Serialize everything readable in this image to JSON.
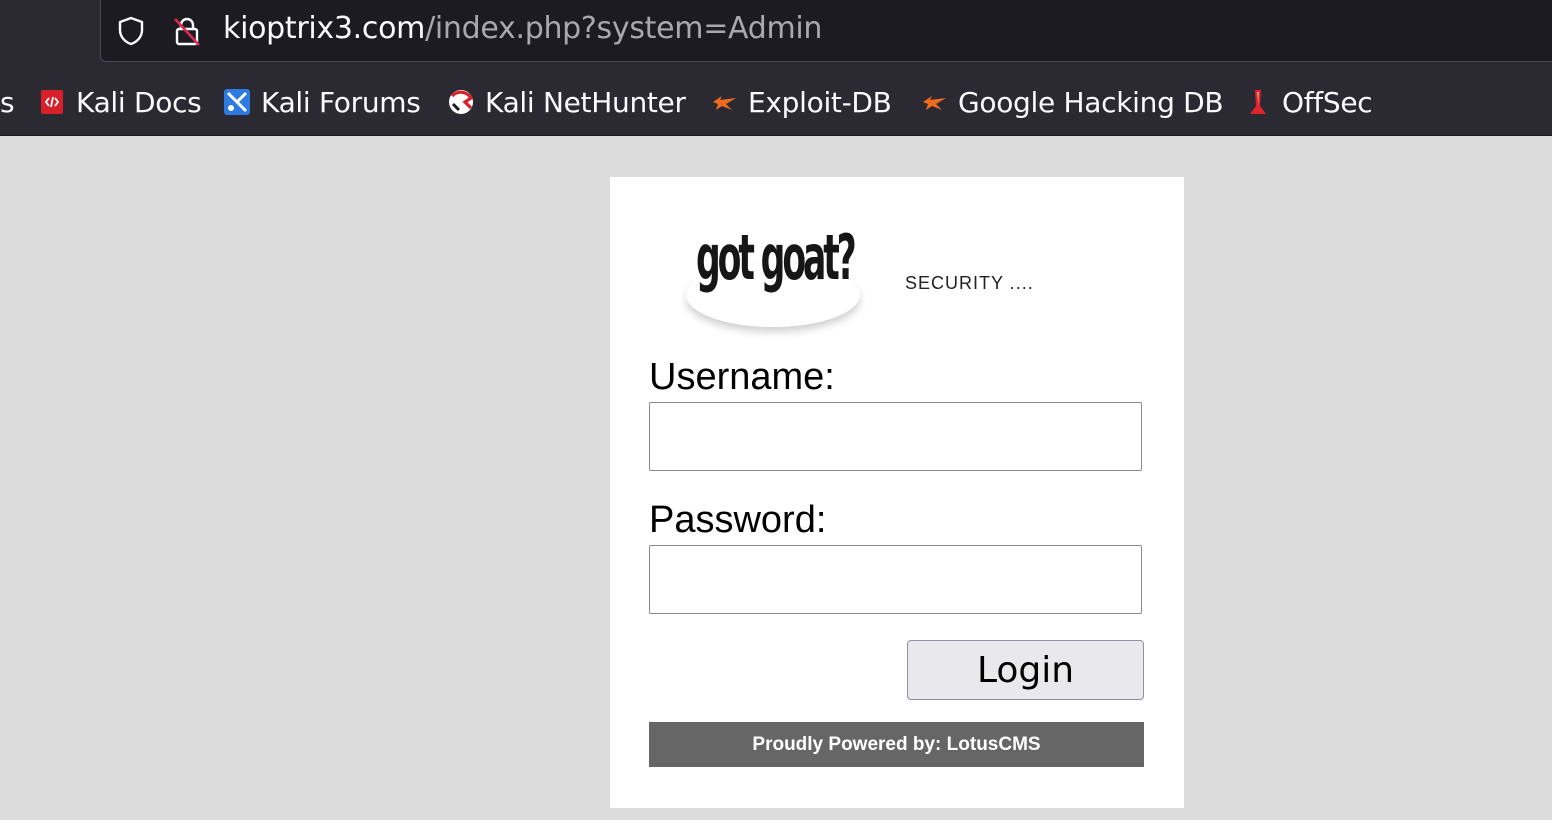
{
  "browser": {
    "url_host": "kioptrix3.com",
    "url_path": "/index.php?system=Admin",
    "bookmarks": [
      {
        "label": "s"
      },
      {
        "label": "Kali Docs",
        "icon": "kali-docs-icon"
      },
      {
        "label": "Kali Forums",
        "icon": "kali-forums-icon"
      },
      {
        "label": "Kali NetHunter",
        "icon": "kali-nethunter-icon"
      },
      {
        "label": "Exploit-DB",
        "icon": "exploit-db-icon"
      },
      {
        "label": "Google Hacking DB",
        "icon": "ghdb-icon"
      },
      {
        "label": "OffSec",
        "icon": "offsec-icon"
      }
    ]
  },
  "page": {
    "logo_text": "got goat?",
    "tagline": "SECURITY ....",
    "username_label": "Username:",
    "username_value": "",
    "password_label": "Password:",
    "password_value": "",
    "login_label": "Login",
    "footer": "Proudly Powered by: LotusCMS"
  },
  "colors": {
    "chrome_bg": "#2b2a33",
    "urlbar_bg": "#1c1b22",
    "page_bg": "#dcdcdc",
    "footer_bg": "#666666",
    "button_bg": "#e9e9ed"
  }
}
